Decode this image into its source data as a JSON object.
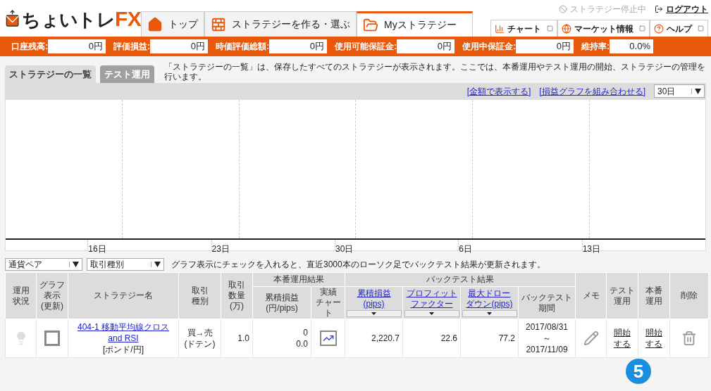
{
  "logo": {
    "text": "ちょいトレ",
    "accent": "FX"
  },
  "nav_tabs": [
    {
      "label": "トップ",
      "selected": false
    },
    {
      "label": "ストラテジーを作る・選ぶ",
      "selected": false
    },
    {
      "label": "Myストラテジー",
      "selected": true
    }
  ],
  "strategy_status": {
    "label": "ストラテジー停止中",
    "disabled": true
  },
  "logout": "ログアウト",
  "tools": [
    {
      "label": "チャート"
    },
    {
      "label": "マーケット情報"
    },
    {
      "label": "ヘルプ"
    }
  ],
  "account": [
    {
      "label": "口座残高:",
      "value": "0円"
    },
    {
      "label": "評価損益:",
      "value": "0円"
    },
    {
      "label": "時価評価総額:",
      "value": "0円"
    },
    {
      "label": "使用可能保証金:",
      "value": "0円"
    },
    {
      "label": "使用中保証金:",
      "value": "0円"
    },
    {
      "label": "維持率:",
      "value": "0.0%"
    }
  ],
  "sub_tabs": [
    {
      "label": "ストラテジーの一覧",
      "selected": true
    },
    {
      "label": "テスト運用",
      "selected": false
    }
  ],
  "description": "「ストラテジーの一覧」は、保存したすべてのストラテジーが表示されます。ここでは、本番運用やテスト運用の開始、ストラテジーの管理を行います。",
  "chart_links": [
    "[金額で表示する]",
    "[損益グラフを組み合わせる]"
  ],
  "period_select": "30日",
  "chart": {
    "x_labels": [
      "16日",
      "23日",
      "30日",
      "6日",
      "13日"
    ]
  },
  "filters": [
    "通貨ペア",
    "取引種別"
  ],
  "filter_note": "グラフ表示にチェックを入れると、直近3000本のローソク足でバックテスト結果が更新されます。",
  "table": {
    "live_group": "本番運用結果",
    "backtest_group": "バックテスト結果",
    "columns": [
      [
        "運用",
        "状況"
      ],
      [
        "グラフ",
        "表示",
        "(更新)"
      ],
      [
        "ストラテジー名"
      ],
      [
        "取引",
        "種別"
      ],
      [
        "取引",
        "数量",
        "(万)"
      ],
      [
        "累積損益",
        "(円/pips)"
      ],
      [
        "実績",
        "チャート"
      ],
      [
        "累積損益",
        "(pips)"
      ],
      [
        "プロフィット",
        "ファクター"
      ],
      [
        "最大ドロー",
        "ダウン(pips)"
      ],
      [
        "バックテスト",
        "期間"
      ],
      [
        "メモ"
      ],
      [
        "テスト",
        "運用"
      ],
      [
        "本番",
        "運用"
      ],
      [
        "削除"
      ]
    ],
    "rows": [
      {
        "running": false,
        "graph_checked": false,
        "name": "404-1 移動平均線クロス and RSI",
        "pair": "[ポンド/円]",
        "trade_type": [
          "買→売",
          "(ドテン)"
        ],
        "quantity": "1.0",
        "live_pnl": [
          "0",
          "0.0"
        ],
        "bt_pnl": "2,220.7",
        "profit_factor": "22.6",
        "max_drawdown": "77.2",
        "period": [
          "2017/08/31",
          "～",
          "2017/11/09"
        ],
        "test_start": "開始する",
        "live_start": "開始する"
      }
    ]
  },
  "step_badge": "5"
}
